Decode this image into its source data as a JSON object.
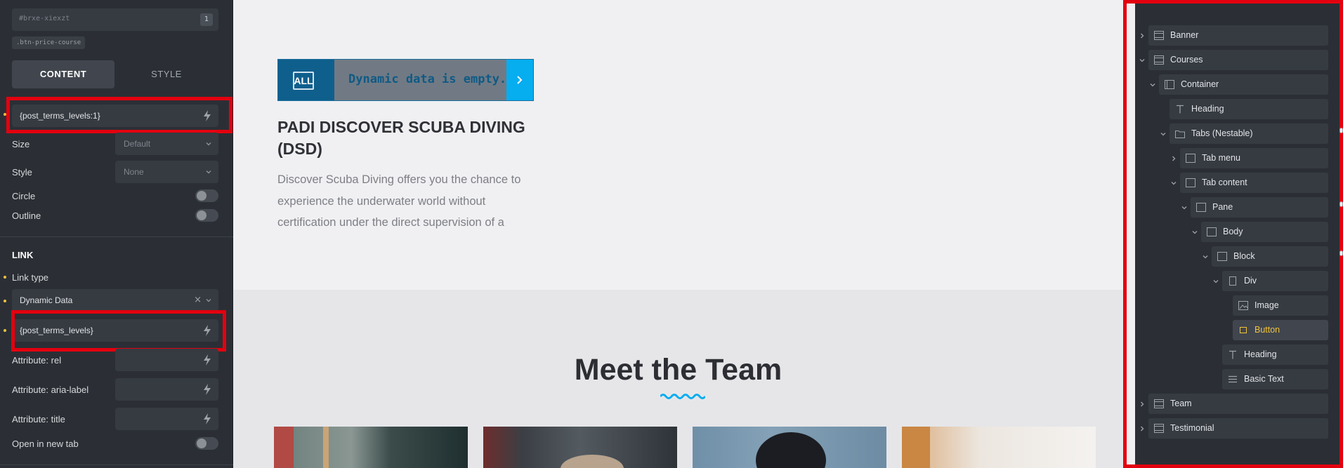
{
  "left_panel": {
    "element_id": "#brxe-xiexzt",
    "element_id_count": "1",
    "css_class": ".btn-price-course",
    "tabs": {
      "content": "CONTENT",
      "style": "STYLE"
    },
    "text_field_value": "{post_terms_levels:1}",
    "size": {
      "label": "Size",
      "value": "Default"
    },
    "style": {
      "label": "Style",
      "value": "None"
    },
    "circle": {
      "label": "Circle",
      "on": false
    },
    "outline": {
      "label": "Outline",
      "on": false
    },
    "link_section": "LINK",
    "link_type": {
      "label": "Link type",
      "value": "Dynamic Data",
      "clear": "×"
    },
    "dynamic_data_value": "{post_terms_levels}",
    "attr_rel": "Attribute: rel",
    "attr_aria": "Attribute: aria-label",
    "attr_title": "Attribute: title",
    "open_new_tab": {
      "label": "Open in new tab",
      "on": false
    }
  },
  "canvas": {
    "course_button": {
      "badge": "ALL",
      "text": "Dynamic data is empty."
    },
    "course_title": "PADI DISCOVER SCUBA DIVING (DSD)",
    "course_desc": "Discover Scuba Diving offers you the chance to experience the underwater world without certification under the direct supervision of a",
    "team_title": "Meet the Team",
    "accent_color": "#06adef"
  },
  "structure": {
    "items": [
      {
        "label": "Banner",
        "icon": "section-icon",
        "expand": "collapsed"
      },
      {
        "label": "Courses",
        "icon": "section-icon",
        "expand": "expanded"
      },
      {
        "label": "Container",
        "icon": "container-icon",
        "expand": "expanded"
      },
      {
        "label": "Heading",
        "icon": "heading-icon",
        "expand": "none"
      },
      {
        "label": "Tabs (Nestable)",
        "icon": "folder-icon",
        "expand": "expanded"
      },
      {
        "label": "Tab menu",
        "icon": "block-icon",
        "expand": "collapsed"
      },
      {
        "label": "Tab content",
        "icon": "block-icon",
        "expand": "expanded"
      },
      {
        "label": "Pane",
        "icon": "block-icon",
        "expand": "expanded"
      },
      {
        "label": "Body",
        "icon": "block-icon",
        "expand": "expanded"
      },
      {
        "label": "Block",
        "icon": "block-icon",
        "expand": "expanded"
      },
      {
        "label": "Div",
        "icon": "div-icon",
        "expand": "expanded"
      },
      {
        "label": "Image",
        "icon": "image-icon",
        "expand": "none"
      },
      {
        "label": "Button",
        "icon": "button-icon",
        "expand": "none",
        "active": true
      },
      {
        "label": "Heading",
        "icon": "heading-icon",
        "expand": "none"
      },
      {
        "label": "Basic Text",
        "icon": "text-icon",
        "expand": "none"
      },
      {
        "label": "Team",
        "icon": "section-icon",
        "expand": "collapsed"
      },
      {
        "label": "Testimonial",
        "icon": "section-icon",
        "expand": "collapsed"
      }
    ]
  }
}
